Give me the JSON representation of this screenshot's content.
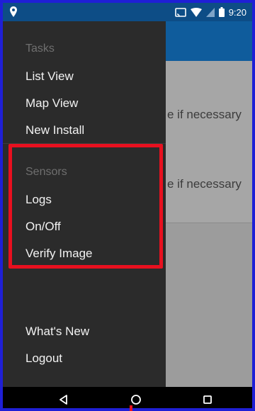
{
  "status_bar": {
    "time": "9:20",
    "icons": [
      "location-pin-icon",
      "cast-icon",
      "wifi-icon",
      "signal-icon",
      "battery-icon"
    ]
  },
  "background_content": {
    "items": [
      {
        "text": "e if necessary"
      },
      {
        "text": "e if necessary"
      }
    ]
  },
  "drawer": {
    "sections": [
      {
        "header": "Tasks",
        "items": [
          {
            "label": "List View"
          },
          {
            "label": "Map View"
          },
          {
            "label": "New Install"
          }
        ]
      },
      {
        "header": "Sensors",
        "items": [
          {
            "label": "Logs"
          },
          {
            "label": "On/Off"
          },
          {
            "label": "Verify Image"
          }
        ]
      }
    ],
    "footer_items": [
      {
        "label": "What's New"
      },
      {
        "label": "Logout"
      }
    ]
  },
  "colors": {
    "status_bar": "#0d4d86",
    "app_bar": "#0f5c9c",
    "drawer": "#2b2b2b",
    "highlight": "#e8101f",
    "frame": "#1f1fd6"
  }
}
